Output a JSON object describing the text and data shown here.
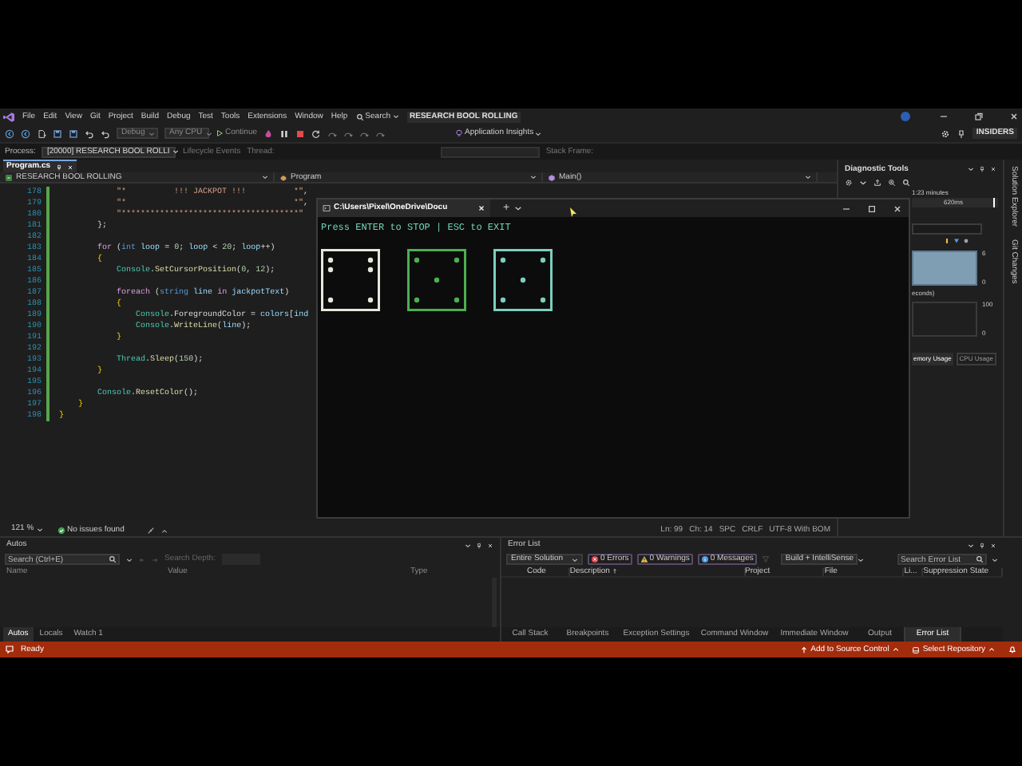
{
  "menu_bar": {
    "items": [
      "File",
      "Edit",
      "View",
      "Git",
      "Project",
      "Build",
      "Debug",
      "Test",
      "Tools",
      "Extensions",
      "Window",
      "Help"
    ],
    "search": "Search",
    "solution_name": "RESEARCH BOOL ROLLING"
  },
  "toolbar": {
    "configuration": "Debug",
    "platform": "Any CPU",
    "continue": "Continue",
    "insights": "Application Insights",
    "badge": "INSIDERS"
  },
  "debug_location": {
    "label": "Process:",
    "process": "[20000] RESEARCH BOOL ROLLI",
    "lifecycle": "Lifecycle Events",
    "thread": "Thread:",
    "stack_frame": "Stack Frame:"
  },
  "editor": {
    "tabs": [
      {
        "label": "Program.cs",
        "selected": true
      }
    ],
    "nav": {
      "project": "RESEARCH BOOL ROLLING",
      "class": "Program",
      "member": "Main()"
    },
    "lines": [
      {
        "number": "178",
        "tokens": [
          {
            "kind": "string",
            "text": "            \"*          !!! JACKPOT !!!          *\""
          },
          {
            "kind": "plain",
            "text": ","
          }
        ]
      },
      {
        "number": "179",
        "tokens": [
          {
            "kind": "string",
            "text": "            \"*                                   *\""
          },
          {
            "kind": "plain",
            "text": ","
          }
        ]
      },
      {
        "number": "180",
        "tokens": [
          {
            "kind": "string",
            "text": "            \"*************************************\""
          }
        ]
      },
      {
        "number": "181",
        "tokens": [
          {
            "kind": "plain",
            "text": "        };"
          }
        ]
      },
      {
        "number": "182"
      },
      {
        "number": "183",
        "tokens": [
          {
            "kind": "control",
            "text": "        for"
          },
          {
            "kind": "plain",
            "text": " ("
          },
          {
            "kind": "keyword",
            "text": "int"
          },
          {
            "kind": "variable",
            "text": " loop"
          },
          {
            "kind": "plain",
            "text": " = "
          },
          {
            "kind": "number",
            "text": "0"
          },
          {
            "kind": "plain",
            "text": "; "
          },
          {
            "kind": "variable",
            "text": "loop"
          },
          {
            "kind": "plain",
            "text": " < "
          },
          {
            "kind": "number",
            "text": "20"
          },
          {
            "kind": "plain",
            "text": "; "
          },
          {
            "kind": "variable",
            "text": "loop"
          },
          {
            "kind": "plain",
            "text": "++)"
          }
        ]
      },
      {
        "number": "184",
        "tokens": [
          {
            "kind": "brace",
            "text": "        {"
          }
        ]
      },
      {
        "number": "185",
        "tokens": [
          {
            "kind": "type",
            "text": "            Console"
          },
          {
            "kind": "plain",
            "text": "."
          },
          {
            "kind": "method",
            "text": "SetCursorPosition"
          },
          {
            "kind": "plain",
            "text": "("
          },
          {
            "kind": "number",
            "text": "0"
          },
          {
            "kind": "plain",
            "text": ", "
          },
          {
            "kind": "number",
            "text": "12"
          },
          {
            "kind": "plain",
            "text": ");"
          }
        ]
      },
      {
        "number": "186"
      },
      {
        "number": "187",
        "tokens": [
          {
            "kind": "control",
            "text": "            foreach"
          },
          {
            "kind": "plain",
            "text": " ("
          },
          {
            "kind": "keyword",
            "text": "string"
          },
          {
            "kind": "variable",
            "text": " line"
          },
          {
            "kind": "control",
            "text": " in"
          },
          {
            "kind": "variable",
            "text": " jackpotText"
          },
          {
            "kind": "plain",
            "text": ")"
          }
        ]
      },
      {
        "number": "188",
        "tokens": [
          {
            "kind": "brace",
            "text": "            {"
          }
        ]
      },
      {
        "number": "189",
        "tokens": [
          {
            "kind": "type",
            "text": "                Console"
          },
          {
            "kind": "plain",
            "text": ".ForegroundColor = "
          },
          {
            "kind": "variable",
            "text": "colors"
          },
          {
            "kind": "plain",
            "text": "["
          },
          {
            "kind": "variable",
            "text": "ind"
          }
        ]
      },
      {
        "number": "190",
        "tokens": [
          {
            "kind": "type",
            "text": "                Console"
          },
          {
            "kind": "plain",
            "text": "."
          },
          {
            "kind": "method",
            "text": "WriteLine"
          },
          {
            "kind": "plain",
            "text": "("
          },
          {
            "kind": "variable",
            "text": "line"
          },
          {
            "kind": "plain",
            "text": ");"
          }
        ]
      },
      {
        "number": "191",
        "tokens": [
          {
            "kind": "brace",
            "text": "            }"
          }
        ]
      },
      {
        "number": "192"
      },
      {
        "number": "193",
        "tokens": [
          {
            "kind": "type",
            "text": "            Thread"
          },
          {
            "kind": "plain",
            "text": "."
          },
          {
            "kind": "method",
            "text": "Sleep"
          },
          {
            "kind": "plain",
            "text": "("
          },
          {
            "kind": "number",
            "text": "150"
          },
          {
            "kind": "plain",
            "text": ");"
          }
        ]
      },
      {
        "number": "194",
        "tokens": [
          {
            "kind": "brace",
            "text": "        }"
          }
        ]
      },
      {
        "number": "195"
      },
      {
        "number": "196",
        "tokens": [
          {
            "kind": "type",
            "text": "        Console"
          },
          {
            "kind": "plain",
            "text": "."
          },
          {
            "kind": "method",
            "text": "ResetColor"
          },
          {
            "kind": "plain",
            "text": "();"
          }
        ]
      },
      {
        "number": "197",
        "tokens": [
          {
            "kind": "brace",
            "text": "    }"
          }
        ]
      },
      {
        "number": "198",
        "tokens": [
          {
            "kind": "brace",
            "text": "}"
          }
        ]
      }
    ],
    "zoom": "121 %",
    "issues": "No issues found",
    "position": [
      "Ln: 99",
      "Ch: 14",
      "SPC",
      "CRLF",
      "UTF-8 With BOM"
    ]
  },
  "console": {
    "tab": "C:\\Users\\Pixel\\OneDrive\\Docu",
    "new_tab": "+",
    "prompt": "Press ENTER to STOP | ESC to EXIT",
    "dice": [
      {
        "kind": "six",
        "color": "#e6e6dc"
      },
      {
        "kind": "five",
        "color": "#4caf50"
      },
      {
        "kind": "five",
        "color": "#7ccfbe"
      }
    ]
  },
  "diagnostics": {
    "title": "Diagnostic Tools",
    "duration": "1:23 minutes",
    "time_mark": "620ms",
    "memory_max": "6",
    "memory_min": "0",
    "cpu_caption": "econds)",
    "cpu_max": "100",
    "cpu_min": "0",
    "tabs": [
      {
        "label": "emory Usage",
        "selected": true
      },
      {
        "label": "CPU Usage",
        "selected": false
      }
    ]
  },
  "side_tabs": [
    "Solution Explorer",
    "Git Changes"
  ],
  "autos": {
    "title": "Autos",
    "search_placeholder": "Search (Ctrl+E)",
    "search_depth": "Search Depth:",
    "columns": [
      "Name",
      "Value",
      "Type"
    ],
    "tabs": [
      {
        "label": "Autos",
        "selected": true
      },
      {
        "label": "Locals",
        "selected": false
      },
      {
        "label": "Watch 1",
        "selected": false
      }
    ]
  },
  "error_list": {
    "title": "Error List",
    "scope": "Entire Solution",
    "filters": [
      {
        "kind": "error",
        "label": "0 Errors"
      },
      {
        "kind": "warning",
        "label": "0 Warnings"
      },
      {
        "kind": "message",
        "label": "0 Messages"
      }
    ],
    "source": "Build + IntelliSense",
    "search_placeholder": "Search Error List",
    "columns": [
      "Code",
      "Description",
      "Project",
      "File",
      "Li...",
      "Suppression State"
    ]
  },
  "tool_tabs": [
    {
      "label": "Call Stack",
      "selected": false
    },
    {
      "label": "Breakpoints",
      "selected": false
    },
    {
      "label": "Exception Settings",
      "selected": false
    },
    {
      "label": "Command Window",
      "selected": false
    },
    {
      "label": "Immediate Window",
      "selected": false
    },
    {
      "label": "Output",
      "selected": false
    },
    {
      "label": "Error List",
      "selected": true
    }
  ],
  "status_bar": {
    "message": "Ready",
    "source_control": "Add to Source Control",
    "repository": "Select Repository"
  }
}
